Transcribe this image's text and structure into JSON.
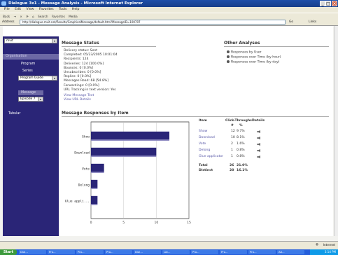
{
  "window": {
    "title": "Dialogue 3x1 - Message Analysis - Microsoft Internet Explorer",
    "controls": [
      "_",
      "□",
      "×"
    ]
  },
  "menu": [
    "File",
    "Edit",
    "View",
    "Favorites",
    "Tools",
    "Help"
  ],
  "toolbar": [
    "Back",
    "→",
    "×",
    "⟳",
    "⌂",
    "Search",
    "Favorites",
    "Media"
  ],
  "address": {
    "label": "Address",
    "url": "http://dialogue.mvit.net/Results/GraphicalMessage/default.htm?MessageID=100707",
    "go": "Go",
    "links": "Links"
  },
  "sidebar": {
    "top_select": "mvit",
    "organisation_label": "Organisation",
    "program_label": "Program",
    "series_label": "Series",
    "program_select": "Program Guide",
    "message_label": "Message",
    "message_select": "Episode 7",
    "tabular_link": "Tabular"
  },
  "message_status": {
    "heading": "Message Status",
    "rows": [
      "Delivery status:  Sent",
      "Completed:          05/23/2005 10:01:04",
      "Recipients:          124",
      "Deliveries:          124   [100.0%]",
      "Bounces:            0        [0.0%]",
      "Unsubscribes:     0        [0.0%]",
      "Replies:              0        [0.0%]",
      "Messages Read:  68      [54.8%]",
      "Forwardings:       0        [0.0%]",
      "URL Tracking in text version: Yes"
    ],
    "links": [
      "View Message Text",
      "View URL Details"
    ]
  },
  "other_analyses": {
    "heading": "Other Analyses",
    "items": [
      "Responses by User",
      "Responses over Time (by hour)",
      "Responses over Time (by day)"
    ]
  },
  "responses": {
    "heading": "Message Responses by Item",
    "table_headers": {
      "item": "Item",
      "ct": "Click-Throughs",
      "details": "Details",
      "num": "#",
      "pct": "%"
    },
    "rows": [
      {
        "item": "Show",
        "n": "12",
        "pct": "9.7%"
      },
      {
        "item": "Download",
        "n": "10",
        "pct": "8.1%"
      },
      {
        "item": "Vote",
        "n": "2",
        "pct": "1.6%"
      },
      {
        "item": "Delong",
        "n": "1",
        "pct": "0.8%"
      },
      {
        "item": "Glue applicator",
        "n": "1",
        "pct": "0.8%"
      }
    ],
    "total": {
      "label": "Total",
      "n": "26",
      "pct": "21.0%"
    },
    "distinct": {
      "label": "Distinct",
      "n": "20",
      "pct": "16.1%"
    }
  },
  "chart_data": {
    "type": "bar",
    "orientation": "horizontal",
    "categories": [
      "Show",
      "Download",
      "Vote",
      "Delong",
      "Glue appli..."
    ],
    "values": [
      12,
      10,
      2,
      1,
      1
    ],
    "xlim": [
      0,
      15
    ],
    "xticks": [
      "0",
      "5",
      "10",
      "15"
    ],
    "bar_color": "#2a2577",
    "grid": true
  },
  "status": {
    "zone": "Internet"
  },
  "taskbar": {
    "start": "Start",
    "items": [
      "Dial...",
      "Pro...",
      "Pro...",
      "Pro...",
      "Dial...",
      "Lot...",
      "Pro...",
      "Pro...",
      "Pro...",
      "Ad..."
    ],
    "clock": "3:14 PM"
  }
}
